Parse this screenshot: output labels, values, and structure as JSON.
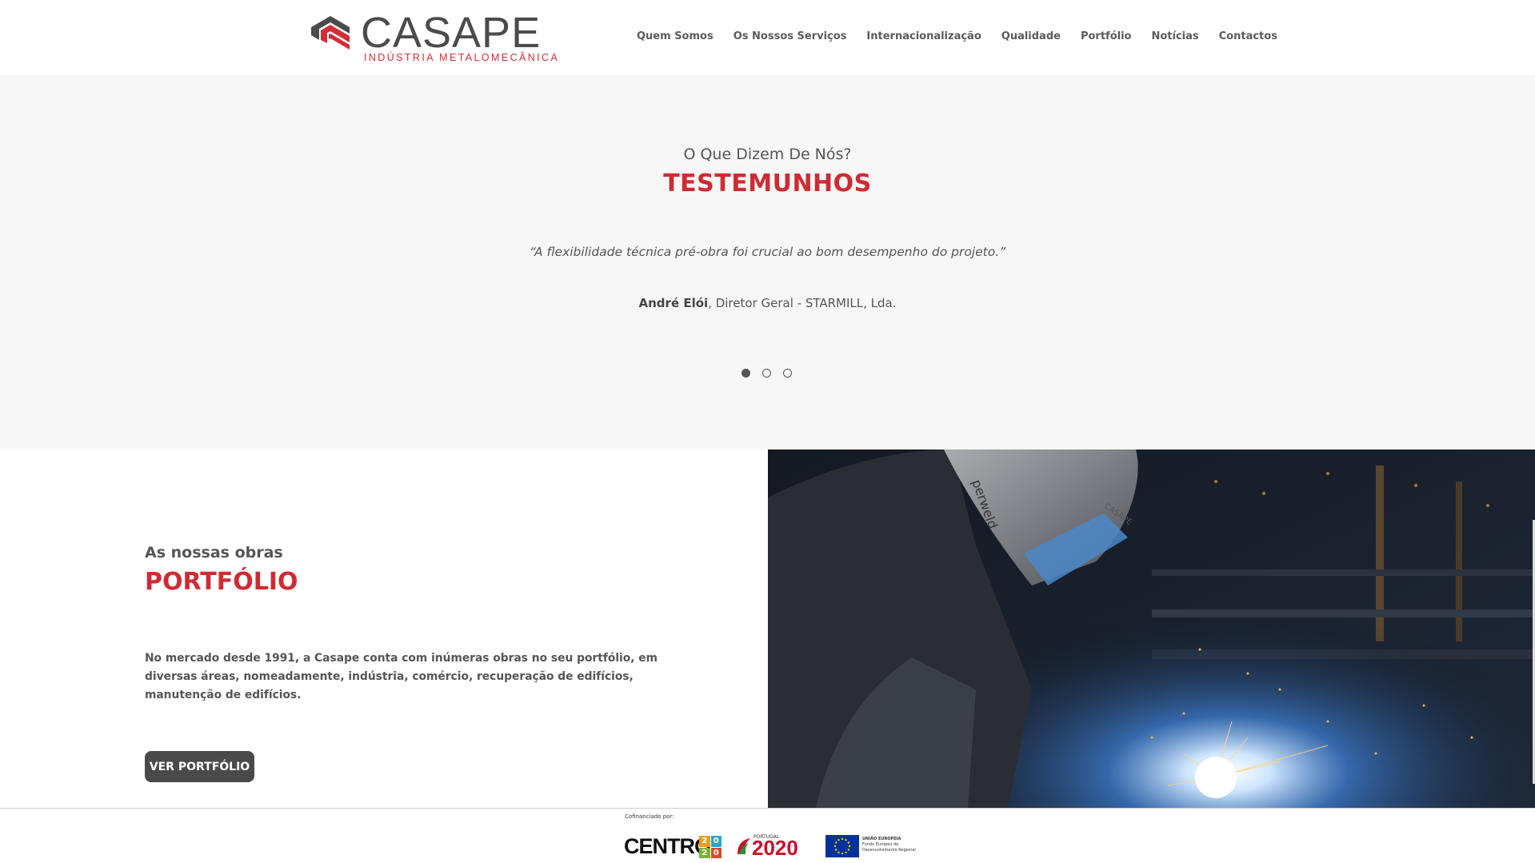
{
  "header": {
    "logo_word": "CASAPE",
    "logo_tagline": "INDÚSTRIA METALOMECÂNICA",
    "nav": [
      "Quem Somos",
      "Os Nossos Serviços",
      "Internacionalização",
      "Qualidade",
      "Portfólio",
      "Notícias",
      "Contactos"
    ]
  },
  "testimonials": {
    "subtitle": "O Que Dizem De Nós?",
    "title": "TESTEMUNHOS",
    "quote": "“A flexibilidade técnica pré-obra foi crucial ao bom desempenho do projeto.”",
    "author_name": "André Elói",
    "author_role": ", Diretor Geral - STARMILL, Lda.",
    "slides_total": 3,
    "active_slide": 1
  },
  "portfolio": {
    "subtitle": "As nossas obras",
    "title": "PORTFÓLIO",
    "text": "No mercado desde 1991, a Casape conta com inúmeras obras no seu portfólio, em diversas áreas, nomeadamente, indústria, comércio, recuperação de edifícios, manutenção de edifícios.",
    "button": "VER PORTFÓLIO",
    "image_helmet_brand": "perweld",
    "image_helmet_label": "CASAPE"
  },
  "funding": {
    "caption": "Cofinanciado por:",
    "centro": "CENTRO",
    "centro_digits": [
      "2",
      "0",
      "2",
      "0"
    ],
    "portugal_label": "PORTUGAL",
    "portugal_year": "2020",
    "eu_label": "UNIÃO EUROPEIA",
    "eu_fund": "Fundo Europeu de Desenvolvimento Regional"
  },
  "colors": {
    "brand_red": "#d02a33",
    "text_gray": "#555555",
    "button_dark": "#4a4a4a",
    "section_bg": "#f7f7f7"
  }
}
